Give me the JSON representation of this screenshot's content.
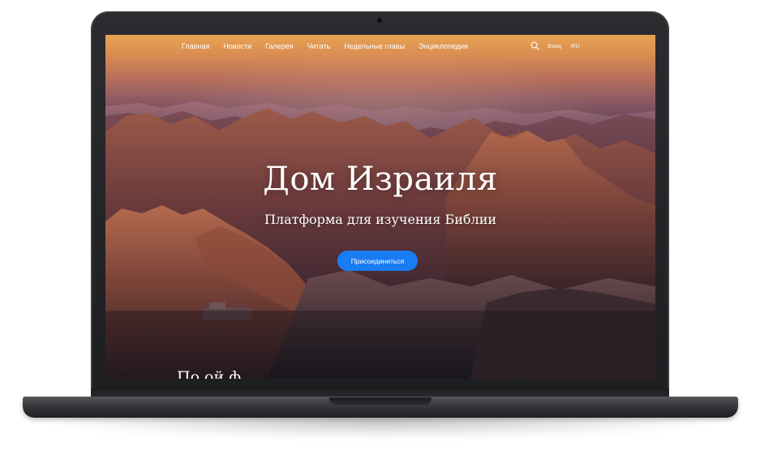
{
  "nav": {
    "links": [
      "Главная",
      "Новости",
      "Галерея",
      "Читать",
      "Недельные главы",
      "Энциклопедия"
    ],
    "login": "Вход",
    "language": "RU",
    "search_icon": "search-icon"
  },
  "hero": {
    "title": "Дом Израиля",
    "subtitle": "Платформа для изучения Библии",
    "cta": "Присоединиться"
  },
  "next_section": {
    "title_partial": "По   ой ф"
  },
  "colors": {
    "accent": "#1a7cf2",
    "sky_top": "#e9a351",
    "text": "#ffffff",
    "laptop_frame": "#1d1e20"
  }
}
